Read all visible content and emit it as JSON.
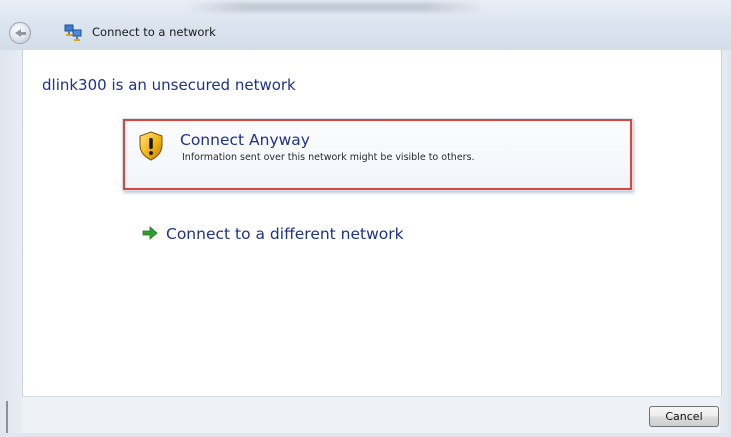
{
  "window": {
    "title": "Connect to a network"
  },
  "main": {
    "heading": "dlink300 is an unsecured network",
    "options": [
      {
        "label": "Connect Anyway",
        "description": "Information sent over this network might be visible to others.",
        "icon": "security-shield-warning-icon",
        "highlighted": true,
        "highlight_color": "#d9453f"
      },
      {
        "label": "Connect to a different network",
        "icon": "green-arrow-icon"
      }
    ]
  },
  "footer": {
    "cancel_label": "Cancel"
  },
  "colors": {
    "link_blue": "#1e3287",
    "arrow_green": "#2e9e2e",
    "titlebar": "#dde6f0"
  }
}
